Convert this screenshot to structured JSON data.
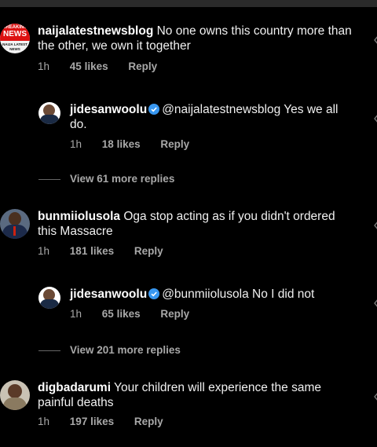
{
  "comments": [
    {
      "username": "naijalatestnewsblog",
      "text": "No one owns this country more than the other, we own it together",
      "time": "1h",
      "likes": "45 likes",
      "reply": "Reply",
      "avatar_text": [
        "BREAKING",
        "NEWS",
        "NAIJA LATEST",
        "NEWS"
      ]
    },
    {
      "username": "jidesanwoolu",
      "mention": "@naijalatestnewsblog",
      "text": "Yes we all do.",
      "time": "1h",
      "likes": "18 likes",
      "reply": "Reply"
    },
    {
      "username": "bunmiiolusola",
      "text": "Oga stop acting as if you didn't ordered this Massacre",
      "time": "1h",
      "likes": "181 likes",
      "reply": "Reply"
    },
    {
      "username": "jidesanwoolu",
      "mention": "@bunmiiolusola",
      "text": "No I did not",
      "time": "1h",
      "likes": "65 likes",
      "reply": "Reply"
    },
    {
      "username": "digbadarumi",
      "text": "Your children will experience the same painful deaths",
      "time": "1h",
      "likes": "197 likes",
      "reply": "Reply"
    }
  ],
  "view_more": [
    "View 61 more replies",
    "View 201 more replies"
  ],
  "colors": {
    "background": "#000000",
    "verified": "#3897f0",
    "meta": "#a8a8a8"
  },
  "icons": [
    "heart-icon",
    "verified-badge-icon"
  ]
}
